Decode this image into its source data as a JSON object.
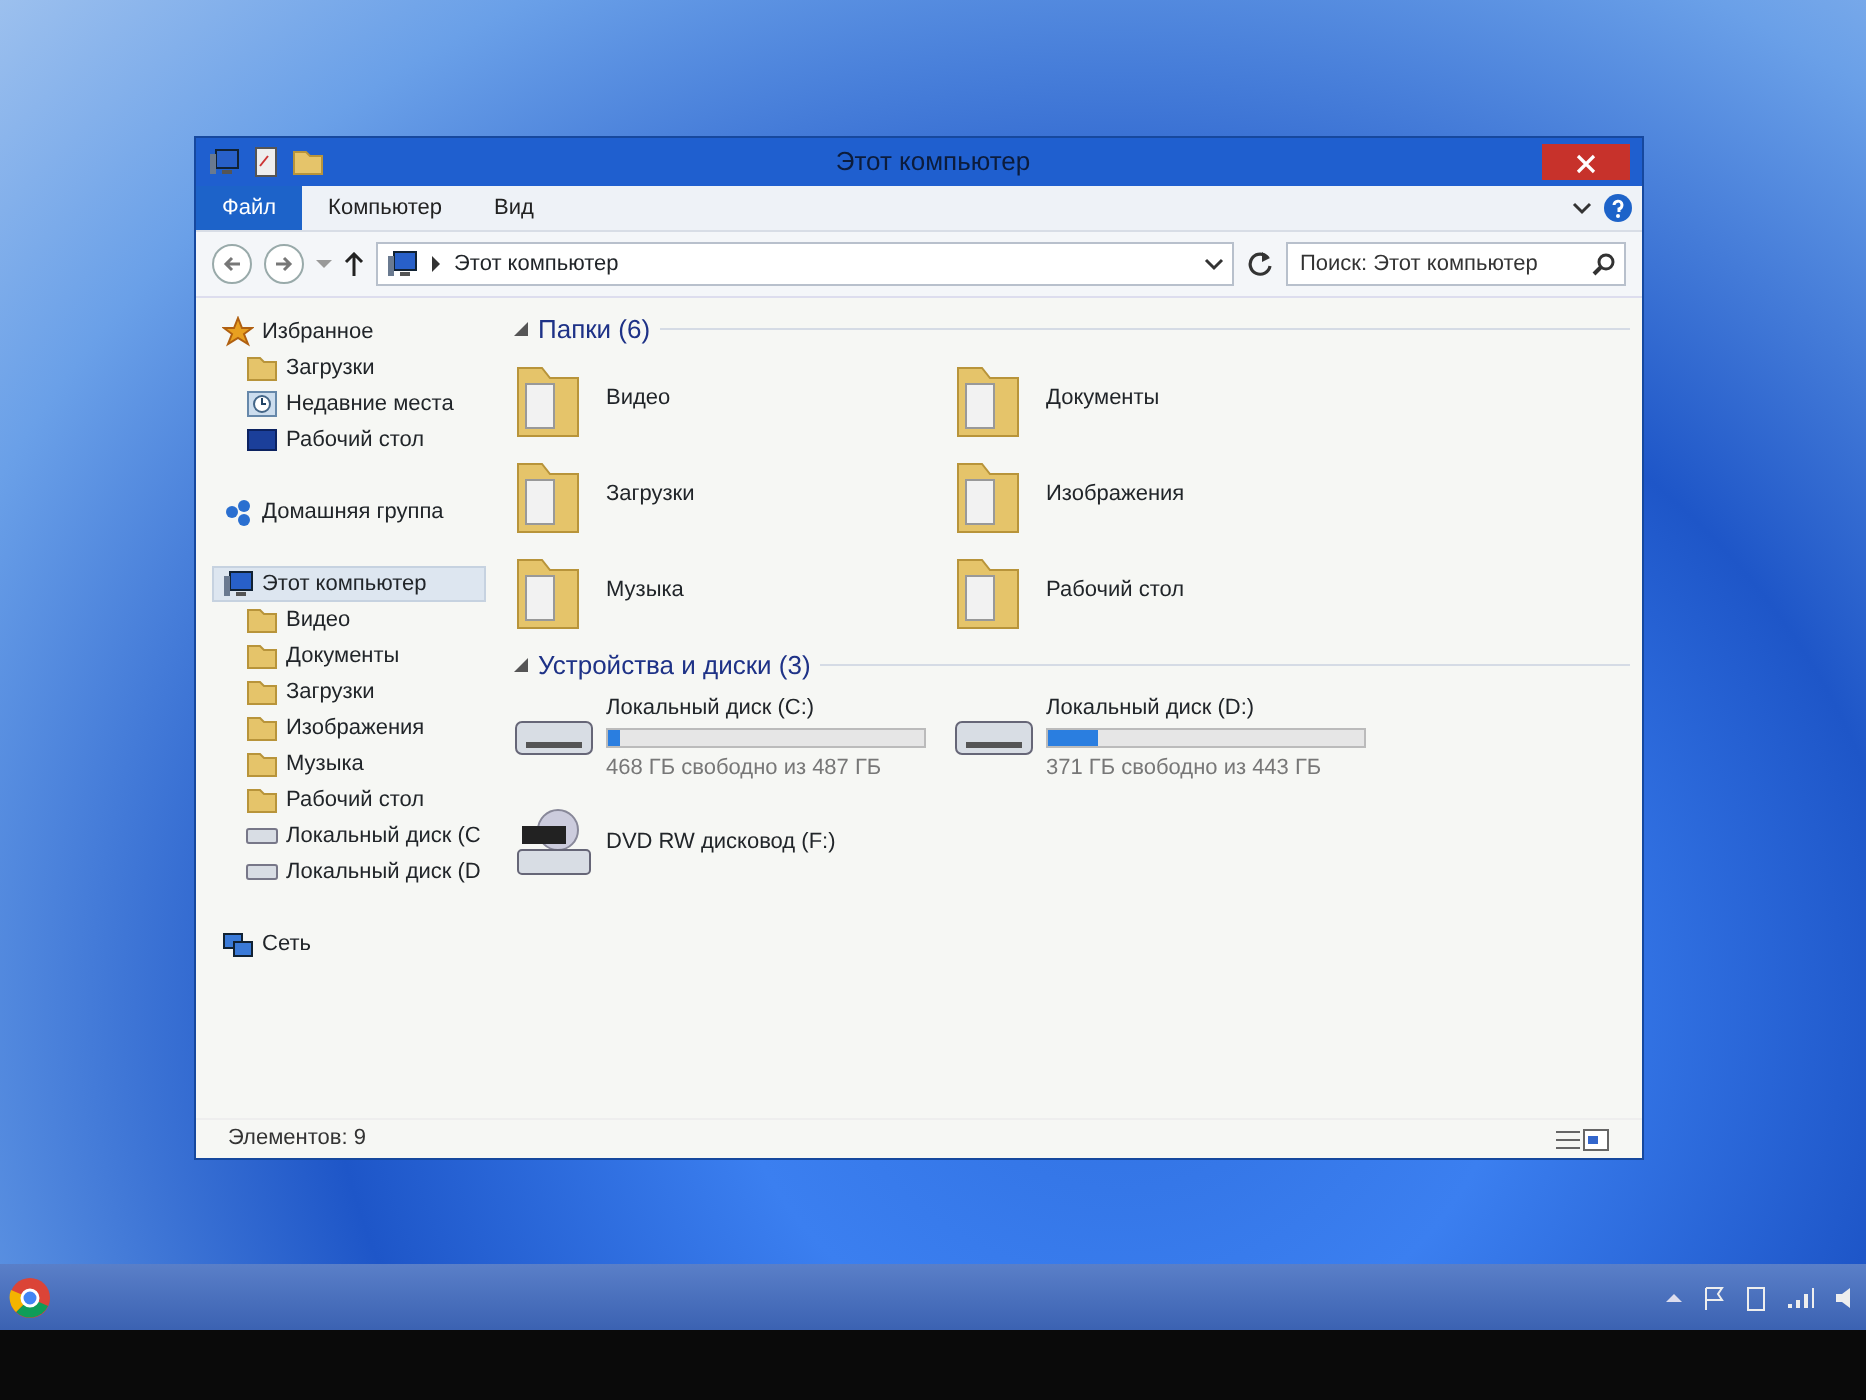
{
  "window": {
    "title": "Этот компьютер"
  },
  "ribbon": {
    "tabs": [
      {
        "label": "Файл",
        "selected": true
      },
      {
        "label": "Компьютер",
        "selected": false
      },
      {
        "label": "Вид",
        "selected": false
      }
    ]
  },
  "address": {
    "path": "Этот компьютер"
  },
  "search": {
    "placeholder": "Поиск: Этот компьютер"
  },
  "sidebar": {
    "items": [
      {
        "label": "Избранное",
        "kind": "favorites",
        "selected": false,
        "children": [
          {
            "label": "Загрузки",
            "kind": "folder",
            "selected": false
          },
          {
            "label": "Недавние места",
            "kind": "recent",
            "selected": false
          },
          {
            "label": "Рабочий стол",
            "kind": "desktop",
            "selected": false
          }
        ]
      },
      {
        "label": "Домашняя группа",
        "kind": "homegroup",
        "selected": false
      },
      {
        "label": "Этот компьютер",
        "kind": "computer",
        "selected": true,
        "children": [
          {
            "label": "Видео",
            "kind": "folder",
            "selected": false
          },
          {
            "label": "Документы",
            "kind": "folder",
            "selected": false
          },
          {
            "label": "Загрузки",
            "kind": "folder",
            "selected": false
          },
          {
            "label": "Изображения",
            "kind": "folder",
            "selected": false
          },
          {
            "label": "Музыка",
            "kind": "folder",
            "selected": false
          },
          {
            "label": "Рабочий стол",
            "kind": "folder",
            "selected": false
          },
          {
            "label": "Локальный диск (C",
            "kind": "drive",
            "selected": false
          },
          {
            "label": "Локальный диск (D",
            "kind": "drive",
            "selected": false
          }
        ]
      },
      {
        "label": "Сеть",
        "kind": "network",
        "selected": false
      }
    ]
  },
  "folders": {
    "heading": "Папки (6)",
    "items": [
      {
        "label": "Видео"
      },
      {
        "label": "Документы"
      },
      {
        "label": "Загрузки"
      },
      {
        "label": "Изображения"
      },
      {
        "label": "Музыка"
      },
      {
        "label": "Рабочий стол"
      }
    ]
  },
  "devices": {
    "heading": "Устройства и диски (3)",
    "items": [
      {
        "label": "Локальный диск (C:)",
        "kind": "disk",
        "level": 0.04,
        "free": "468 ГБ свободно из 487 ГБ"
      },
      {
        "label": "Локальный диск (D:)",
        "kind": "disk",
        "level": 0.16,
        "free": "371 ГБ свободно из 443 ГБ"
      },
      {
        "label": "DVD RW дисковод (F:)",
        "kind": "dvd"
      }
    ]
  },
  "status_bar": {
    "text": "Элементов: 9"
  }
}
